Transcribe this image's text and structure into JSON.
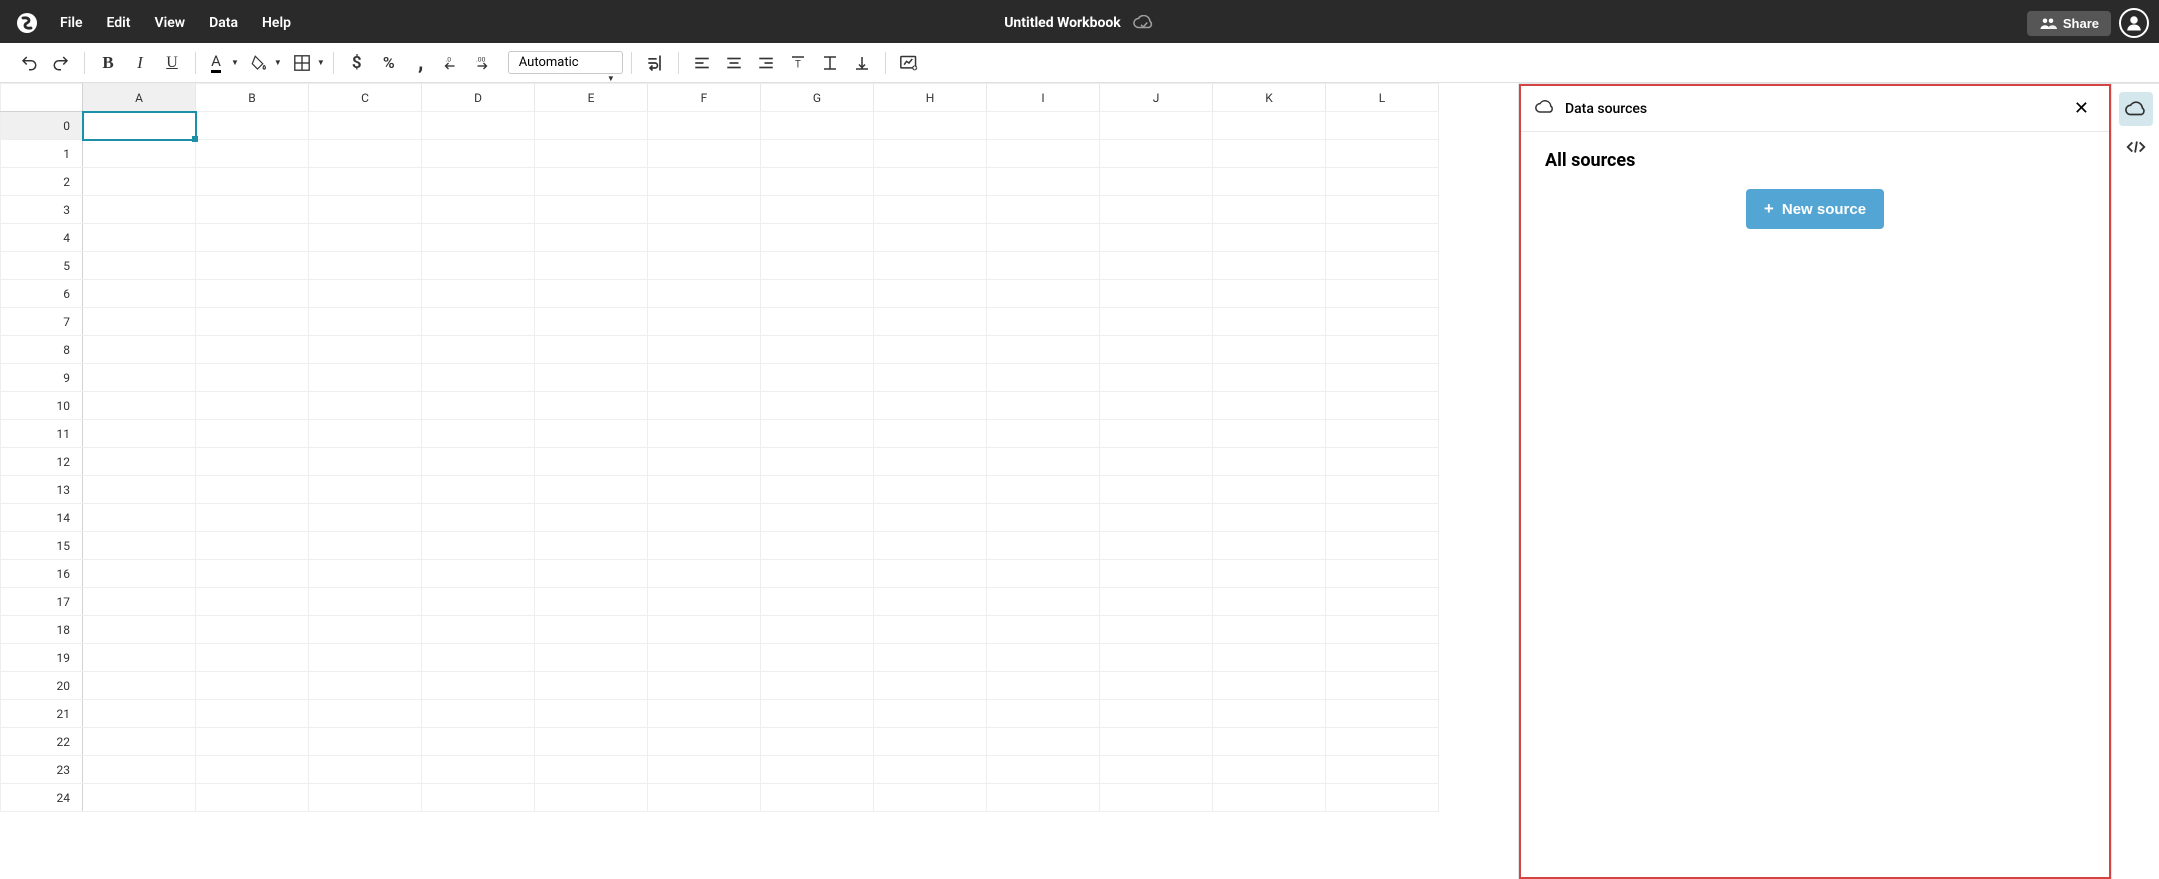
{
  "app": {
    "title": "Untitled Workbook"
  },
  "menu": [
    "File",
    "Edit",
    "View",
    "Data",
    "Help"
  ],
  "share_label": "Share",
  "toolbar": {
    "format_select": "Automatic"
  },
  "sheet": {
    "columns": [
      "A",
      "B",
      "C",
      "D",
      "E",
      "F",
      "G",
      "H",
      "I",
      "J",
      "K",
      "L"
    ],
    "rows": [
      "0",
      "1",
      "2",
      "3",
      "4",
      "5",
      "6",
      "7",
      "8",
      "9",
      "10",
      "11",
      "12",
      "13",
      "14",
      "15",
      "16",
      "17",
      "18",
      "19",
      "20",
      "21",
      "22",
      "23",
      "24"
    ],
    "selected_row": 0,
    "selected_col": 0
  },
  "panel": {
    "title": "Data sources",
    "heading": "All sources",
    "new_btn": "New source"
  }
}
